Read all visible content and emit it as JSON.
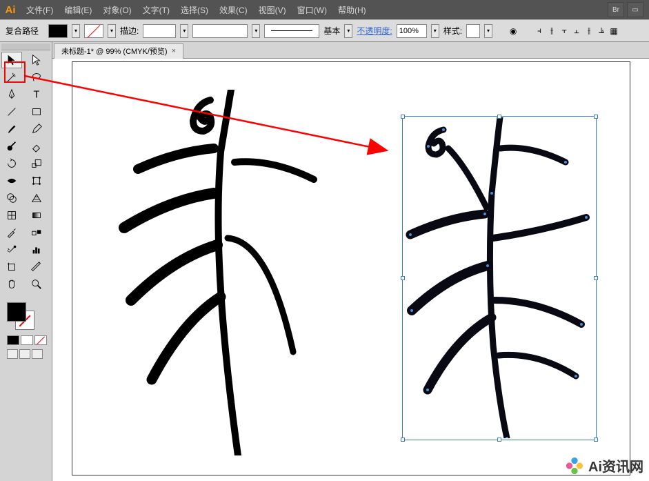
{
  "app": {
    "logo": "Ai"
  },
  "menu": {
    "file": "文件(F)",
    "edit": "编辑(E)",
    "object": "对象(O)",
    "type": "文字(T)",
    "select": "选择(S)",
    "effect": "效果(C)",
    "view": "视图(V)",
    "window": "窗口(W)",
    "help": "帮助(H)"
  },
  "menu_right": {
    "br": "Br"
  },
  "control": {
    "path_label": "复合路径",
    "stroke_label": "描边:",
    "brush_label": "基本",
    "opacity_label": "不透明度:",
    "opacity_value": "100%",
    "style_label": "样式:"
  },
  "document": {
    "tab_title": "未标题-1* @ 99% (CMYK/预览)",
    "tab_close": "×"
  },
  "tools": {
    "selection": "selection-tool",
    "direct": "direct-selection-tool",
    "wand": "magic-wand-tool",
    "lasso": "lasso-tool",
    "pen": "pen-tool",
    "type": "type-tool",
    "line": "line-tool",
    "rect": "rectangle-tool",
    "brush": "paintbrush-tool",
    "pencil": "pencil-tool",
    "blob": "blob-brush-tool",
    "eraser": "eraser-tool",
    "rotate": "rotate-tool",
    "scale": "scale-tool",
    "width": "width-tool",
    "free": "free-transform-tool",
    "shape_builder": "shape-builder-tool",
    "perspective": "perspective-grid-tool",
    "mesh": "mesh-tool",
    "gradient": "gradient-tool",
    "eyedrop": "eyedropper-tool",
    "blend": "blend-tool",
    "symbol": "symbol-sprayer-tool",
    "graph": "column-graph-tool",
    "artboard": "artboard-tool",
    "slice": "slice-tool",
    "hand": "hand-tool",
    "zoom": "zoom-tool"
  },
  "watermark": {
    "text": "Ai资讯网"
  },
  "annotation": {
    "highlight": "selection-tool-highlight"
  }
}
